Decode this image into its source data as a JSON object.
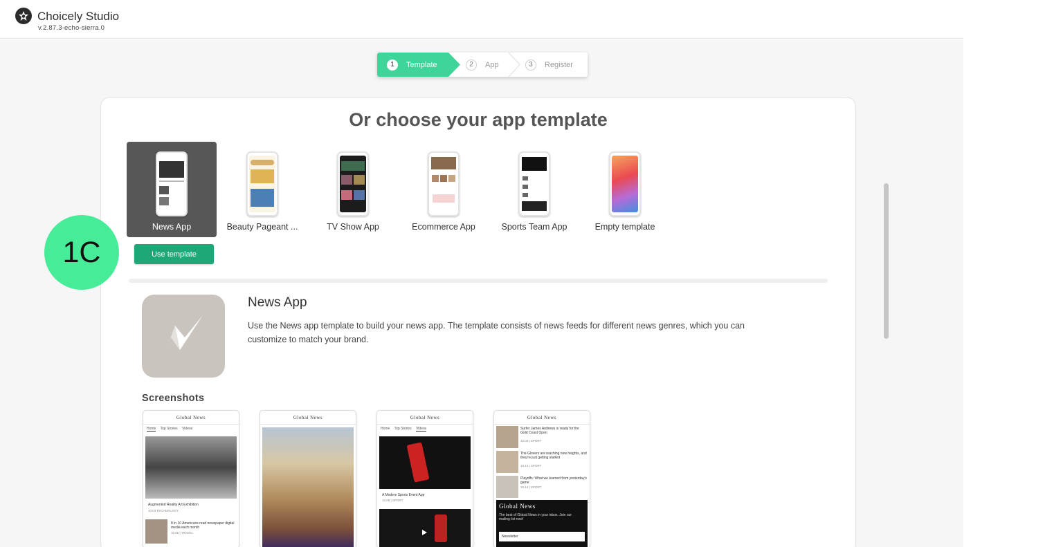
{
  "app": {
    "title": "Choicely Studio",
    "version": "v.2.87.3-echo-sierra.0"
  },
  "stepper": [
    {
      "num": "1",
      "label": "Template"
    },
    {
      "num": "2",
      "label": "App"
    },
    {
      "num": "3",
      "label": "Register"
    }
  ],
  "card": {
    "title": "Or choose your app template"
  },
  "templates": [
    {
      "label": "News App"
    },
    {
      "label": "Beauty Pageant ..."
    },
    {
      "label": "TV Show App"
    },
    {
      "label": "Ecommerce App"
    },
    {
      "label": "Sports Team App"
    },
    {
      "label": "Empty template"
    }
  ],
  "use_template_label": "Use template",
  "badge": "1C",
  "detail": {
    "title": "News App",
    "description": "Use the News app template to build your news app. The template consists of news feeds for different news genres, which you can customize to match your brand."
  },
  "screenshots": {
    "heading": "Screenshots",
    "masthead": "Global News",
    "shot1": {
      "tabs": [
        "Home",
        "Top Stories",
        "Videos"
      ],
      "caption1": "Augmented Reality Art Exhibition",
      "meta1": "10.03 TECHNOLOGY",
      "caption2": "8 in 10 Americans read newspaper digital media each month",
      "meta2": "10.05 | TRAVEL"
    },
    "shot3": {
      "tabs": [
        "Home",
        "Top Stories",
        "Videos"
      ],
      "caption1": "A Modern Sports Event App",
      "meta1": "10.08 | SPORT"
    },
    "shot4": {
      "item1": "Surfer James Andrews is ready for the Gold Coast Open",
      "meta1": "12.03 | SPORT",
      "item2": "The Glovers are reaching new heights, and they're just getting started",
      "meta2": "10.14 | SPORT",
      "item3": "Playoffs: What we learned from yesterday's game",
      "meta3": "10.14 | SPORT",
      "promo_title": "Global News",
      "promo_text": "The best of Global News in your inbox. Join our mailing list now!",
      "newsletter": "Newsletter"
    }
  },
  "colors": {
    "accent": "#3ed49a",
    "button": "#1fa778",
    "badge": "#46ec97",
    "selected_tile": "#575757"
  }
}
